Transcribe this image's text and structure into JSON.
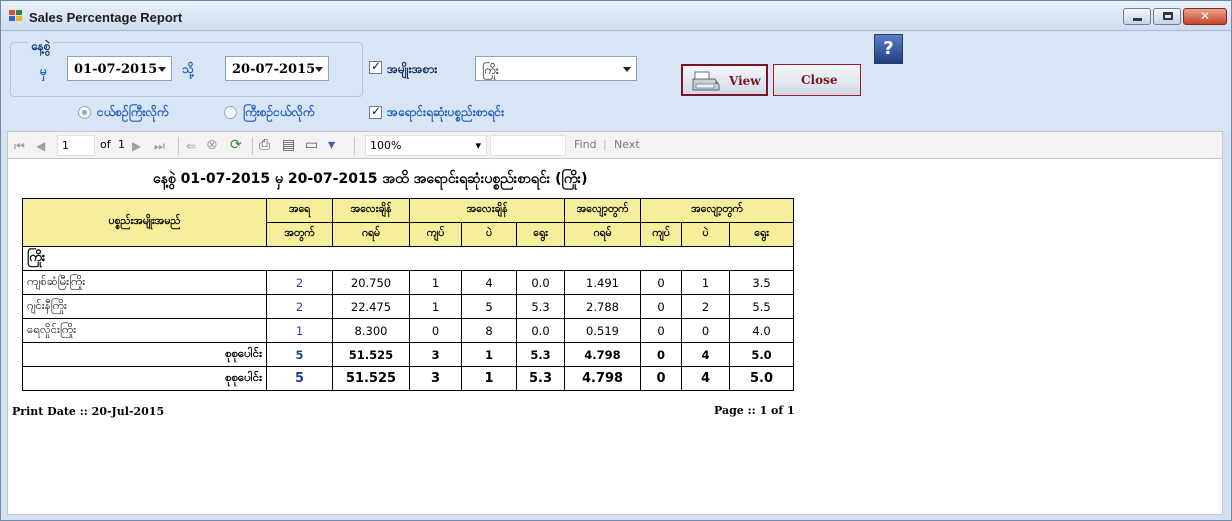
{
  "window": {
    "title": "Sales Percentage Report"
  },
  "filters": {
    "date_group_label": "နေ့စွဲ",
    "from_label": "မှ",
    "from_date": "01-07-2015",
    "to_label": "သို့",
    "to_date": "20-07-2015",
    "type_label": "အမျိုးအစား",
    "type_value": "ကြိုး",
    "radio_weight_label": "ငယ်စဉ်ကြီးလိုက်",
    "radio_big_label": "ကြီးစဉ်ငယ်လိုက်",
    "best_selling_label": "အရောင်းရဆုံးပစ္စည်းစာရင်း"
  },
  "buttons": {
    "view": "View",
    "close": "Close",
    "help": "?"
  },
  "toolbar": {
    "page_value": "1",
    "page_of": "of",
    "page_count": "1",
    "zoom": "100%",
    "find": "Find",
    "next": "Next"
  },
  "report": {
    "title": "နေ့စွဲ 01-07-2015 မှ 20-07-2015 အထိ အရောင်းရဆုံးပစ္စည်းစာရင်း (ကြိုး)",
    "headers": {
      "item": "ပစ္စည်းအမျိုးအမည်",
      "qty_top": "အရေ",
      "qty_bottom": "အတွက်",
      "weight_g_top": "အလေးချိန်",
      "weight_g_bottom": "ဂရမ်",
      "weight_group": "အလေးချိန်",
      "kyat": "ကျပ်",
      "pe": "ပဲ",
      "yway": "ရွေး",
      "loss_g_top": "အလျော့တွက်",
      "loss_g_bottom": "ဂရမ်",
      "loss_group": "အလျော့တွက်"
    },
    "group_name": "ကြိုး",
    "rows": [
      {
        "item": "ကျစ်ဆံမြီးကြိုး",
        "qty": "2",
        "grams": "20.750",
        "kyat": "1",
        "pe": "4",
        "yway": "0.0",
        "loss_g": "1.491",
        "loss_kyat": "0",
        "loss_pe": "1",
        "loss_yway": "3.5"
      },
      {
        "item": "ဂျင်းနီကြိုး",
        "qty": "2",
        "grams": "22.475",
        "kyat": "1",
        "pe": "5",
        "yway": "5.3",
        "loss_g": "2.788",
        "loss_kyat": "0",
        "loss_pe": "2",
        "loss_yway": "5.5"
      },
      {
        "item": "ရေလှိုင်းကြိုး",
        "qty": "1",
        "grams": "8.300",
        "kyat": "0",
        "pe": "8",
        "yway": "0.0",
        "loss_g": "0.519",
        "loss_kyat": "0",
        "loss_pe": "0",
        "loss_yway": "4.0"
      }
    ],
    "subtotal": {
      "label": "စုစုပေါင်း",
      "qty": "5",
      "grams": "51.525",
      "kyat": "3",
      "pe": "1",
      "yway": "5.3",
      "loss_g": "4.798",
      "loss_kyat": "0",
      "loss_pe": "4",
      "loss_yway": "5.0"
    },
    "grand_total": {
      "label": "စုစုပေါင်း",
      "qty": "5",
      "grams": "51.525",
      "kyat": "3",
      "pe": "1",
      "yway": "5.3",
      "loss_g": "4.798",
      "loss_kyat": "0",
      "loss_pe": "4",
      "loss_yway": "5.0"
    },
    "print_date": "Print Date :: 20-Jul-2015",
    "page_info": "Page :: 1 of 1"
  }
}
